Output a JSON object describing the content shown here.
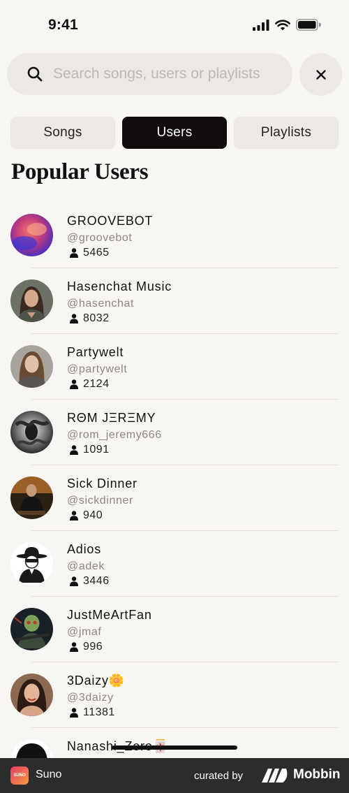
{
  "status_bar": {
    "time": "9:41"
  },
  "search": {
    "placeholder": "Search songs, users or playlists",
    "value": ""
  },
  "tabs": [
    {
      "label": "Songs",
      "active": false
    },
    {
      "label": "Users",
      "active": true
    },
    {
      "label": "Playlists",
      "active": false
    }
  ],
  "section_title": "Popular Users",
  "users": [
    {
      "name": "GROOVEBOT",
      "handle": "@groovebot",
      "followers": "5465",
      "avatar": "abstract-gradient-avatar"
    },
    {
      "name": "Hasenchat Music",
      "handle": "@hasenchat",
      "followers": "8032",
      "avatar": "woman-portrait-avatar"
    },
    {
      "name": "Partywelt",
      "handle": "@partywelt",
      "followers": "2124",
      "avatar": "woman-portrait-avatar"
    },
    {
      "name": "RΘM JΞRΞMY",
      "handle": "@rom_jeremy666",
      "followers": "1091",
      "avatar": "smoke-portrait-avatar"
    },
    {
      "name": "Sick Dinner",
      "handle": "@sickdinner",
      "followers": "940",
      "avatar": "man-sitting-avatar"
    },
    {
      "name": "Adios",
      "handle": "@adek",
      "followers": "3446",
      "avatar": "masked-bandit-avatar"
    },
    {
      "name": "JustMeArtFan",
      "handle": "@jmaf",
      "followers": "996",
      "avatar": "skull-soldier-avatar"
    },
    {
      "name": "3Daizy🌼",
      "handle": "@3daizy",
      "followers": "11381",
      "avatar": "woman-portrait-avatar"
    },
    {
      "name": "Nanashi_Zero🀄",
      "handle": "",
      "followers": "",
      "avatar": "anime-hair-avatar"
    }
  ],
  "footer": {
    "app_name": "Suno",
    "logo_text": "SUNO",
    "curated_by": "curated by",
    "brand": "Mobbin"
  },
  "colors": {
    "background": "#f8f6f3",
    "active_tab": "#130c0c",
    "footer": "#2c2c2c"
  }
}
